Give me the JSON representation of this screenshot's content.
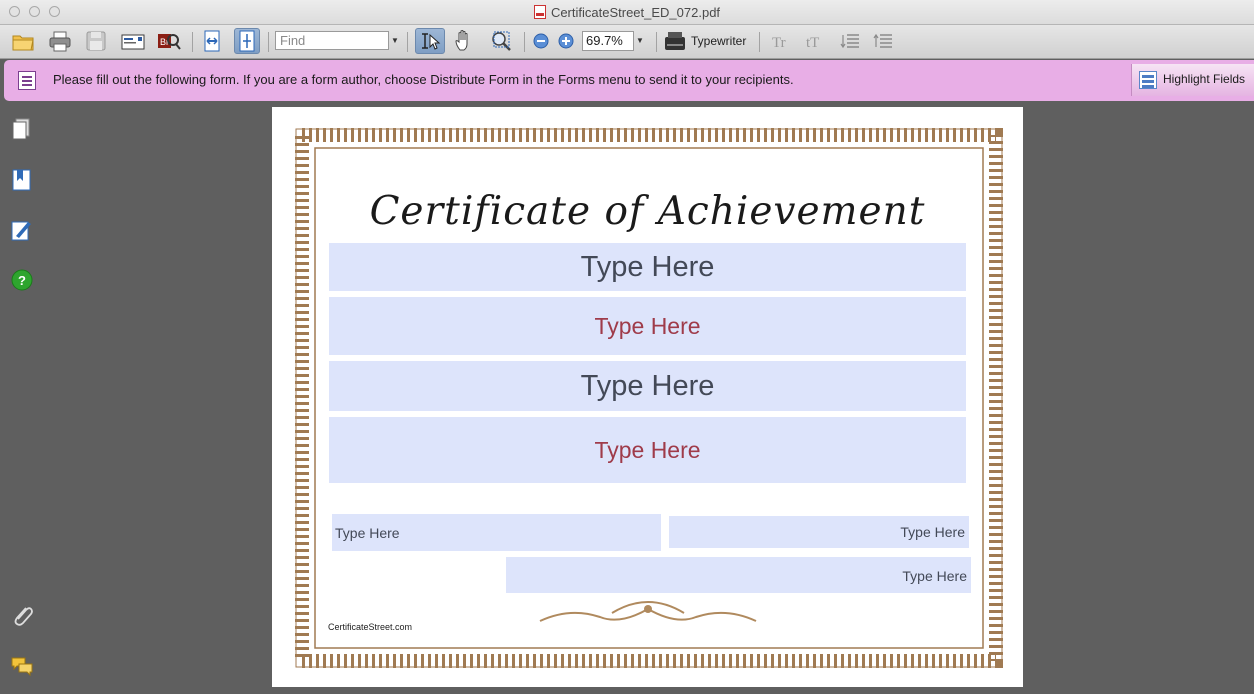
{
  "window": {
    "title": "CertificateStreet_ED_072.pdf"
  },
  "toolbar": {
    "find_placeholder": "Find",
    "zoom_value": "69.7%",
    "typewriter_label": "Typewriter"
  },
  "form_bar": {
    "message": "Please fill out the following form. If you are a form author, choose Distribute Form in the Forms menu to send it to your recipients.",
    "highlight_label": "Highlight Fields"
  },
  "document": {
    "title": "Certificate of Achievement",
    "fields": [
      "Type Here",
      "Type Here",
      "Type Here",
      "Type Here",
      "Type Here",
      "Type Here",
      "Type Here"
    ],
    "site": "CertificateStreet.com"
  },
  "colors": {
    "form_bar": "#e8aee6",
    "field_fill": "#dde4fb",
    "border_brown": "#a07a52",
    "red_text": "#9f3b4a"
  }
}
